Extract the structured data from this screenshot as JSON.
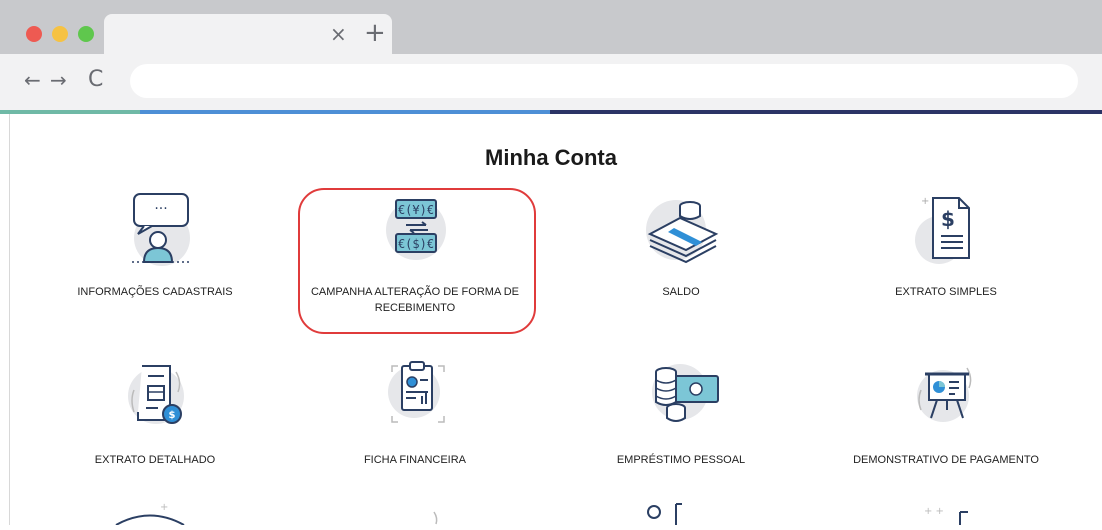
{
  "browser": {
    "tab_close_glyph": "×",
    "new_tab_glyph": "+",
    "back_glyph": "←",
    "forward_glyph": "→",
    "reload_glyph": "C",
    "traffic_lights": [
      "#ee5a52",
      "#f6c243",
      "#5fc74d"
    ],
    "strip_colors": [
      "#6fb9a6",
      "#4d8fd6",
      "#2b3466"
    ]
  },
  "page": {
    "title": "Minha Conta"
  },
  "cards": [
    {
      "label": "INFORMAÇÕES CADASTRAIS",
      "icon": "user-chat-icon"
    },
    {
      "label": "CAMPANHA ALTERAÇÃO DE FORMA DE RECEBIMENTO",
      "icon": "currency-exchange-icon"
    },
    {
      "label": "SALDO",
      "icon": "money-stack-icon"
    },
    {
      "label": "EXTRATO SIMPLES",
      "icon": "dollar-document-icon"
    },
    {
      "label": "EXTRATO DETALHADO",
      "icon": "receipt-coin-icon"
    },
    {
      "label": "FICHA FINANCEIRA",
      "icon": "clipboard-chart-icon"
    },
    {
      "label": "EMPRÉSTIMO PESSOAL",
      "icon": "coins-banknote-icon"
    },
    {
      "label": "DEMONSTRATIVO DE PAGAMENTO",
      "icon": "presentation-board-icon"
    }
  ],
  "accent": {
    "icon_dark": "#2b3f63",
    "icon_teal": "#7cc6d6",
    "icon_blue": "#2f8fd6",
    "icon_bg": "#e6e7ea",
    "highlight": "#e03b3b"
  }
}
